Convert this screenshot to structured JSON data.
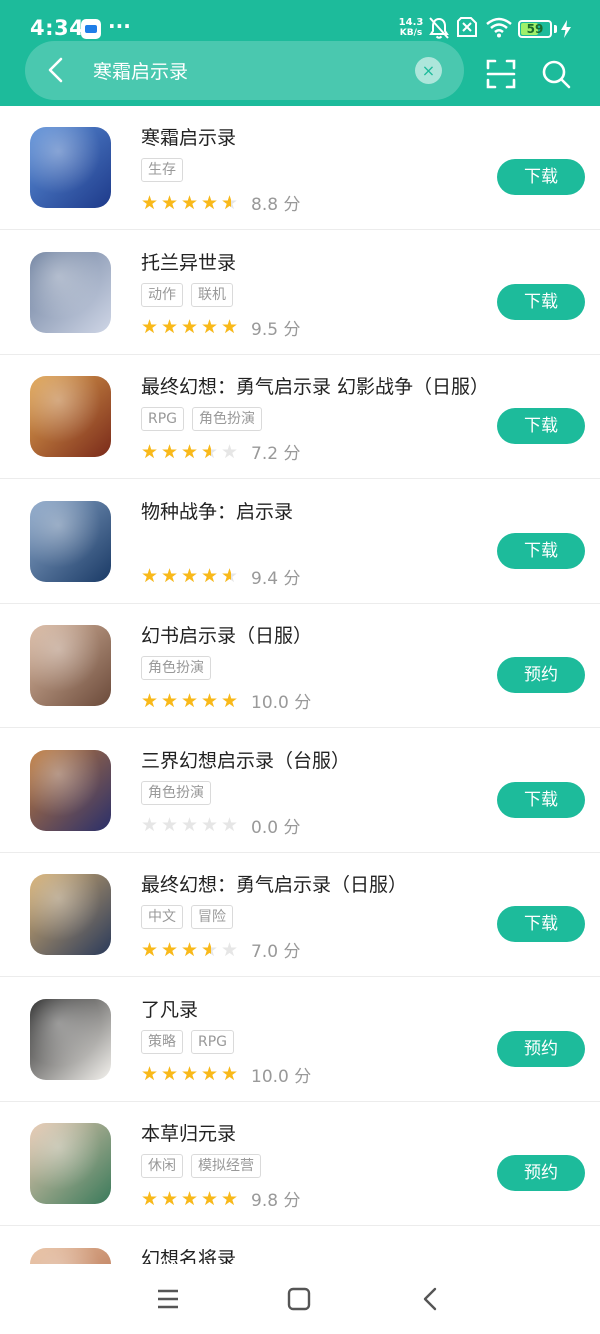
{
  "status_bar": {
    "time": "4:34",
    "dots": "···",
    "net_speed_value": "14.3",
    "net_speed_unit": "KB/s",
    "battery_level": "59",
    "battery_fraction": 0.59,
    "icons": [
      "app-notification-icon",
      "silent-bell-icon",
      "sim-card-icon",
      "wifi-icon",
      "battery-icon",
      "charging-icon"
    ]
  },
  "search": {
    "query": "寒霜启示录",
    "clear_symbol": "×"
  },
  "theme": {
    "accent": "#1dbb9b",
    "star_color": "#f9b919",
    "star_empty": "#e6e6e6"
  },
  "apps": [
    {
      "name": "寒霜启示录",
      "tags": [
        "生存"
      ],
      "rating": 4.5,
      "score": "8.8 分",
      "action": "下载",
      "icon_colors": [
        "#1e3a8a",
        "#5b8fd8"
      ]
    },
    {
      "name": "托兰异世录",
      "tags": [
        "动作",
        "联机"
      ],
      "rating": 5,
      "score": "9.5 分",
      "action": "下载",
      "icon_colors": [
        "#cfd6e6",
        "#6a7d9c"
      ]
    },
    {
      "name": "最终幻想：勇气启示录 幻影战争（日服）",
      "tags": [
        "RPG",
        "角色扮演"
      ],
      "rating": 3.5,
      "score": "7.2 分",
      "action": "下载",
      "icon_colors": [
        "#7a2a1a",
        "#e0a450"
      ]
    },
    {
      "name": "物种战争：启示录",
      "tags": [],
      "rating": 4.5,
      "score": "9.4 分",
      "action": "下载",
      "icon_colors": [
        "#1a3a66",
        "#8aa6c8"
      ]
    },
    {
      "name": "幻书启示录（日服）",
      "tags": [
        "角色扮演"
      ],
      "rating": 5,
      "score": "10.0 分",
      "action": "预约",
      "icon_colors": [
        "#6b4a3a",
        "#d9b8a0"
      ]
    },
    {
      "name": "三界幻想启示录（台服）",
      "tags": [
        "角色扮演"
      ],
      "rating": 0,
      "score": "0.0 分",
      "action": "下载",
      "icon_colors": [
        "#2a2f6a",
        "#c07a3a"
      ]
    },
    {
      "name": "最终幻想：勇气启示录（日服）",
      "tags": [
        "中文",
        "冒险"
      ],
      "rating": 3.5,
      "score": "7.0 分",
      "action": "下载",
      "icon_colors": [
        "#2a3a5a",
        "#d8b070"
      ]
    },
    {
      "name": "了凡录",
      "tags": [
        "策略",
        "RPG"
      ],
      "rating": 5,
      "score": "10.0 分",
      "action": "预约",
      "icon_colors": [
        "#f4f2ee",
        "#222222"
      ]
    },
    {
      "name": "本草归元录",
      "tags": [
        "休闲",
        "模拟经营"
      ],
      "rating": 5,
      "score": "9.8 分",
      "action": "预约",
      "icon_colors": [
        "#3a7a5a",
        "#e8c8b0"
      ]
    },
    {
      "name": "幻想名将录",
      "tags": [],
      "rating": null,
      "score": "",
      "action": "",
      "icon_colors": [
        "#b06a4a",
        "#e8c0a0"
      ]
    }
  ],
  "nav_bar": {
    "buttons": [
      "menu-icon",
      "home-icon",
      "back-icon"
    ]
  }
}
